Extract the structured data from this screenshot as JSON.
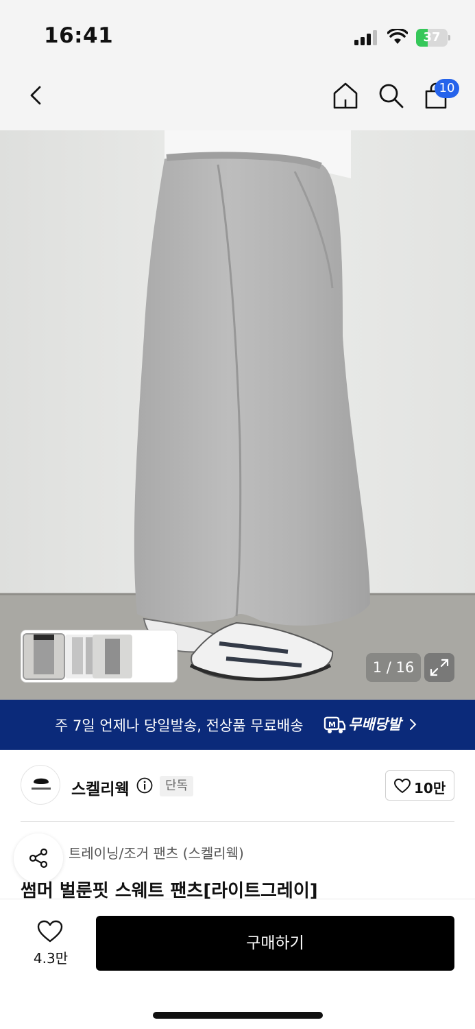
{
  "status_bar": {
    "time": "16:41",
    "battery_level": "37",
    "battery_fraction": 0.37
  },
  "nav": {
    "cart_count": "10"
  },
  "gallery": {
    "page_counter": "1 / 16",
    "thumbnail_count": 3,
    "current_index": 1
  },
  "shipping_banner": {
    "text": "주 7일 언제나 당일발송, 전상품 무료배송",
    "brand": "무배당발"
  },
  "brand": {
    "name": "스켈리웩",
    "badge": "단독",
    "likes": "10만"
  },
  "product": {
    "category": "트레이닝/조거 팬츠 (스켈리웩)",
    "title": "썸머 벌룬핏 스웨트 팬츠[라이트그레이]"
  },
  "bottom_bar": {
    "wish_count": "4.3만",
    "buy_label": "구매하기"
  },
  "colors": {
    "accent_blue": "#2563eb",
    "banner_navy": "#0b2a7a",
    "battery_green": "#35c759",
    "buy_black": "#000000"
  },
  "icons": [
    "back-arrow-icon",
    "home-icon",
    "search-icon",
    "shopping-bag-icon",
    "expand-icon",
    "delivery-truck-icon",
    "chevron-right-icon",
    "info-icon",
    "heart-icon",
    "share-icon"
  ]
}
